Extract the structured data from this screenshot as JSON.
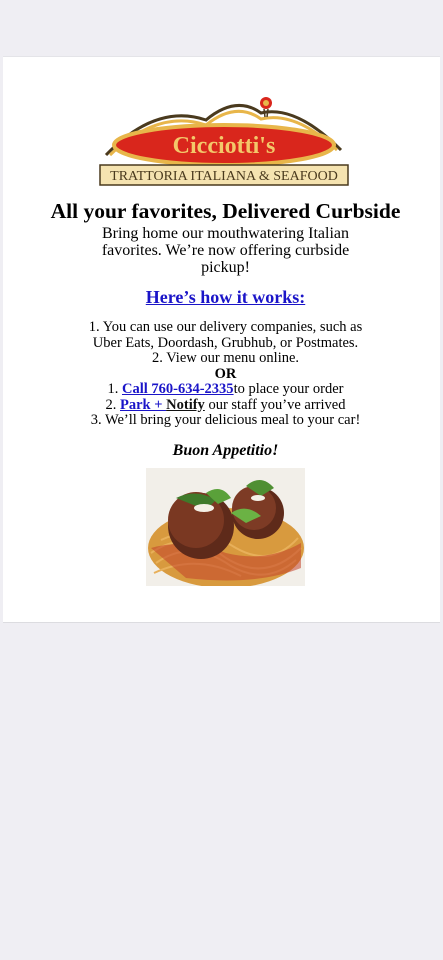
{
  "logo": {
    "name": "Cicciotti's",
    "tagline": "TRATTORIA ITALIANA & SEAFOOD"
  },
  "headline": "All your favorites, Delivered Curbside",
  "intro": "Bring home our mouthwatering Italian favorites. We’re now offering curbside pickup!",
  "how_link": "Here’s how it works:",
  "steps": {
    "line1a": "1. You can use our delivery companies, such as",
    "line1b": "Uber Eats, Doordash, Grubhub, or Postmates.",
    "line2": "2. View our menu online.",
    "or": "OR",
    "call_prefix": "1. ",
    "call_link": "Call 760-634-2335",
    "call_suffix": "to place your order",
    "park_prefix": "2. ",
    "park_link": "Park + ",
    "notify_link": "Notify",
    "park_suffix": " our staff you’ve arrived",
    "line3": "3. We’ll bring your delicious meal to your car!"
  },
  "signoff": "Buon Appetitio!",
  "colors": {
    "link": "#1a14c8",
    "logo_red": "#d9261c",
    "logo_gold": "#e8b64a",
    "background": "#efeef3"
  },
  "images": {
    "food_photo": "spaghetti-and-meatballs-photo"
  }
}
